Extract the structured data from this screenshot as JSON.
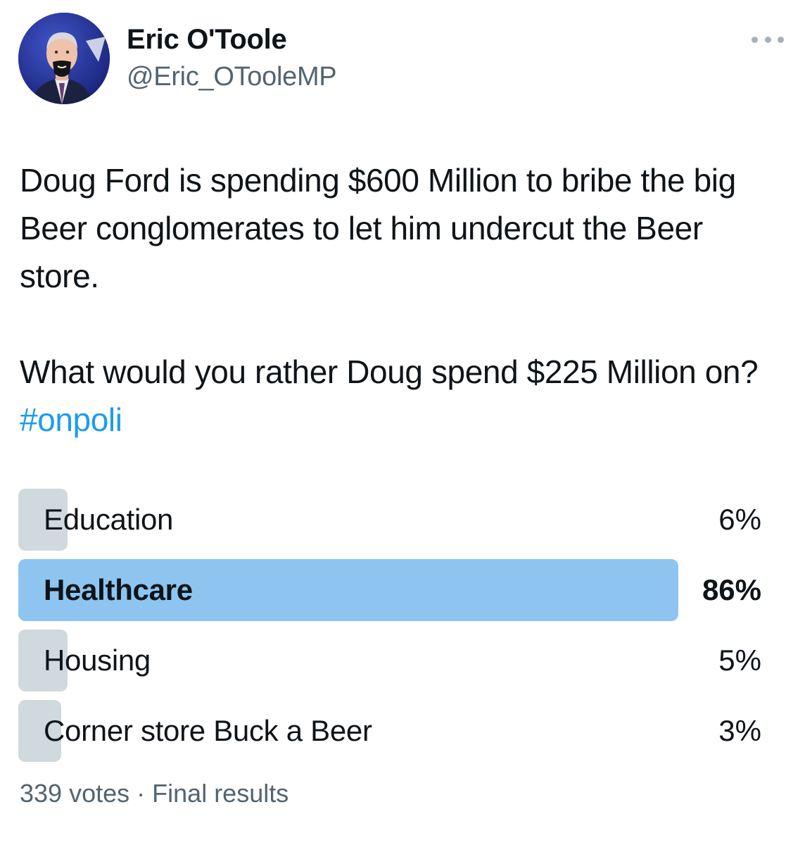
{
  "author": {
    "name": "Eric O'Toole",
    "handle": "@Eric_OTooleMP"
  },
  "menu": {
    "icon": "more-horizontal-icon"
  },
  "tweet": {
    "paragraph1": "Doug Ford is spending $600 Million to bribe the big Beer conglomerates to let him undercut the Beer store.",
    "paragraph2_text": "What would you rather Doug spend $225 Million on? ",
    "hashtag": "#onpoli"
  },
  "poll": {
    "options": [
      {
        "label": "Education",
        "percent_text": "6%",
        "fraction": 0.06,
        "winner": false
      },
      {
        "label": "Healthcare",
        "percent_text": "86%",
        "fraction": 0.86,
        "winner": true
      },
      {
        "label": "Housing",
        "percent_text": "5%",
        "fraction": 0.05,
        "winner": false
      },
      {
        "label": "Corner store Buck a Beer",
        "percent_text": "3%",
        "fraction": 0.03,
        "winner": false
      }
    ],
    "votes": "339 votes",
    "separator": "·",
    "status": "Final results"
  },
  "colors": {
    "winner_bar": "#8ec5f0",
    "loser_bar": "#cfd9de",
    "hashtag": "#1d9bf0",
    "secondary_text": "#536471"
  }
}
